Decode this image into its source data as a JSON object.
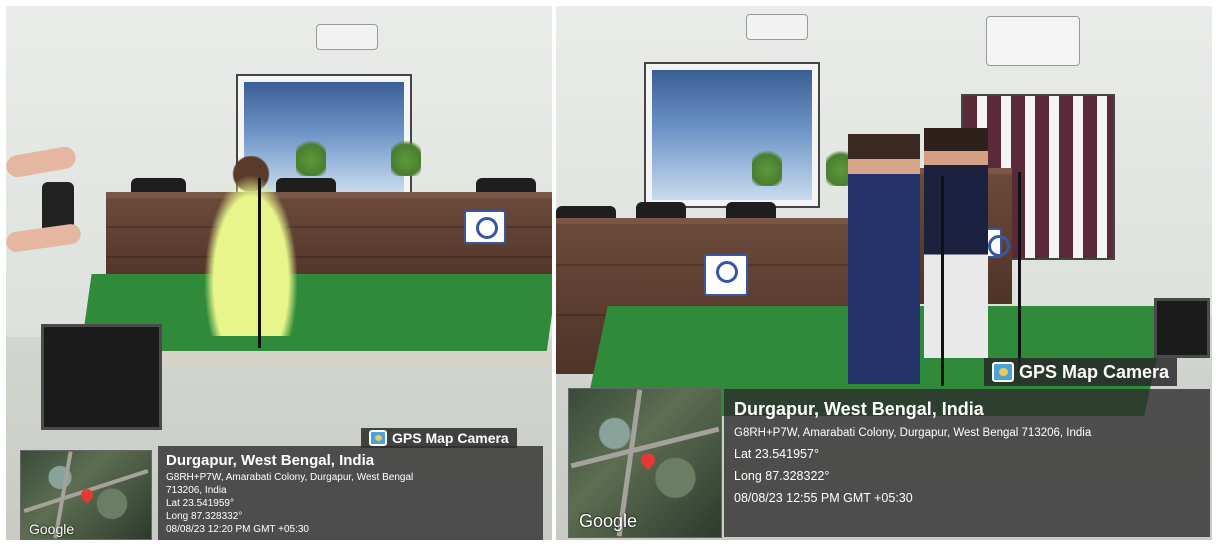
{
  "left_photo": {
    "badge": {
      "icon": "gps-map-camera-icon",
      "label": "GPS Map Camera"
    },
    "map": {
      "attribution": "Google"
    },
    "overlay": {
      "title": "Durgapur, West Bengal, India",
      "address_line1": "G8RH+P7W, Amarabati Colony, Durgapur, West Bengal",
      "address_line2": "713206, India",
      "lat": "Lat 23.541959°",
      "long": "Long 87.328332°",
      "timestamp": "08/08/23 12:20 PM GMT +05:30"
    }
  },
  "right_photo": {
    "badge": {
      "icon": "gps-map-camera-icon",
      "label": "GPS Map Camera"
    },
    "map": {
      "attribution": "Google"
    },
    "overlay": {
      "title": "Durgapur, West Bengal, India",
      "address_line1": "G8RH+P7W, Amarabati Colony, Durgapur, West Bengal 713206, India",
      "lat": "Lat 23.541957°",
      "long": "Long 87.328322°",
      "timestamp": "08/08/23 12:55 PM GMT +05:30"
    }
  },
  "colors": {
    "stage": "#2f8a3a",
    "desk": "#5b3d31",
    "overlay": "#2d2d2d",
    "pin": "#e53935"
  }
}
